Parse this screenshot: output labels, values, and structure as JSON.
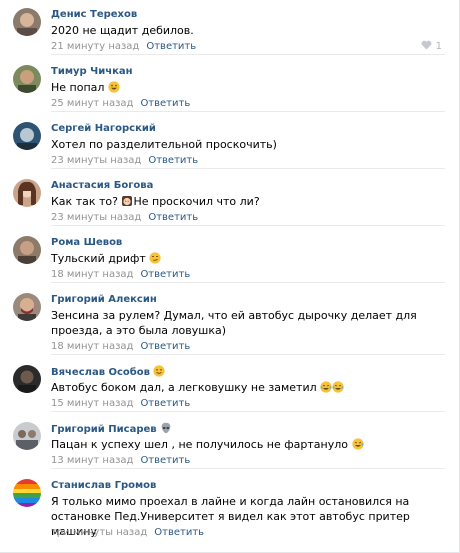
{
  "comments": [
    {
      "author": "Денис Терехов",
      "text": "2020 не щадит дебилов.",
      "time": "21 минуту назад",
      "reply": "Ответить",
      "likes": "1"
    },
    {
      "author": "Тимур Чичкан",
      "text": "Не попал",
      "time": "25 минут назад",
      "reply": "Ответить"
    },
    {
      "author": "Сергей Нагорский",
      "text": "Хотел по разделительной проскочить)",
      "time": "23 минуты назад",
      "reply": "Ответить"
    },
    {
      "author": "Анастасия Богова",
      "text_a": "Как так то?",
      "text_b": "Не проскочил что ли?",
      "time": "23 минуты назад",
      "reply": "Ответить"
    },
    {
      "author": "Рома Шевов",
      "text": "Тульский дрифт",
      "time": "18 минут назад",
      "reply": "Ответить"
    },
    {
      "author": "Григорий Алексин",
      "text": "Зенсина за рулем? Думал, что ей автобус дырочку делает для проезда, а это была ловушка)",
      "time": "18 минут назад",
      "reply": "Ответить"
    },
    {
      "author": "Вячеслав Особов",
      "text": "Автобус боком дал, а легковушку не заметил",
      "time": "15 минут назад",
      "reply": "Ответить"
    },
    {
      "author": "Григорий Писарев",
      "text": "Пацан к успеху шел , не получилось не фартануло",
      "time": "13 минут назад",
      "reply": "Ответить"
    },
    {
      "author": "Станислав Громов",
      "text": "Я только мимо проехал в лайне и когда лайн остановился на остановке Пед.Университет я видел как этот автобус притер машину",
      "time": "три минуты назад",
      "reply": "Ответить"
    }
  ],
  "colors": {
    "link": "#2a5885",
    "meta": "#939393",
    "separator": "#e8eaed"
  }
}
